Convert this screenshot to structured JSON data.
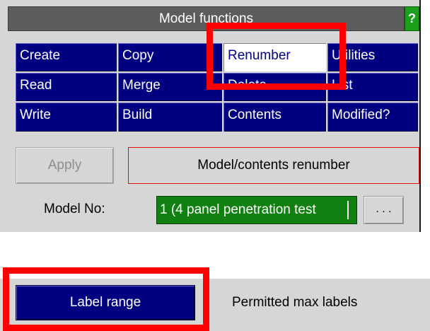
{
  "panel": {
    "title": "Model functions",
    "help_label": "?"
  },
  "function_buttons": [
    {
      "label": "Create",
      "active": false
    },
    {
      "label": "Copy",
      "active": false
    },
    {
      "label": "Renumber",
      "active": true
    },
    {
      "label": "Utilities",
      "active": false
    },
    {
      "label": "Read",
      "active": false
    },
    {
      "label": "Merge",
      "active": false
    },
    {
      "label": "Delete",
      "active": false
    },
    {
      "label": "List",
      "active": false
    },
    {
      "label": "Write",
      "active": false
    },
    {
      "label": "Build",
      "active": false
    },
    {
      "label": "Contents",
      "active": false
    },
    {
      "label": "Modified?",
      "active": false
    }
  ],
  "apply": {
    "label": "Apply",
    "enabled": false
  },
  "mode_label": "Model/contents renumber",
  "model": {
    "label": "Model No:",
    "value": "1 (4 panel penetration test",
    "browse_label": ". . ."
  },
  "label_range_button": "Label range",
  "permitted_max_labels": "Permitted max labels",
  "colors": {
    "button_blue": "#000080",
    "field_green": "#108010",
    "help_green": "#1aa01a",
    "highlight_red": "#ff0000",
    "panel_grey": "#d6d6d6"
  }
}
